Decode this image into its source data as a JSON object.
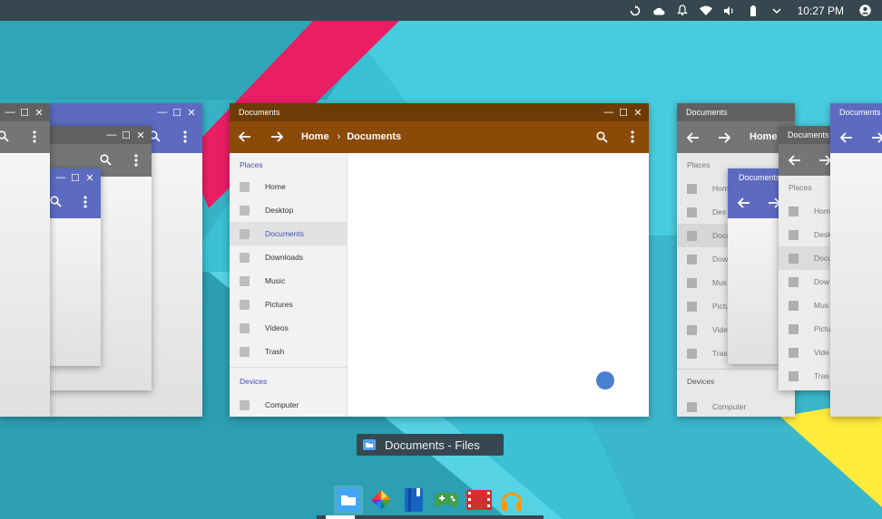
{
  "status_bar": {
    "time": "10:27 PM",
    "icons": [
      "sync-icon",
      "cloud-icon",
      "bell-icon",
      "wifi-icon",
      "volume-icon",
      "battery-icon",
      "chevron-down-icon",
      "account-icon"
    ]
  },
  "main_window": {
    "title": "Documents",
    "breadcrumb": {
      "home": "Home",
      "separator": "›",
      "current": "Documents"
    },
    "sidebar": {
      "places_header": "Places",
      "places": [
        "Home",
        "Desktop",
        "Documents",
        "Downloads",
        "Music",
        "Pictures",
        "Videos",
        "Trash"
      ],
      "active": "Documents",
      "devices_header": "Devices",
      "devices": [
        "Computer"
      ]
    },
    "colors": {
      "titlebar": "#6d3b05",
      "toolbar": "#8b4a08",
      "accent": "#3f51b5"
    }
  },
  "right_windows": {
    "win1": {
      "title": "Documents",
      "home": "Home",
      "places_header": "Places",
      "places": [
        "Hom",
        "Des",
        "Docu",
        "Dow",
        "Mus",
        "Pictu",
        "Vide",
        "Tras"
      ],
      "devices_header": "Devices",
      "devices": [
        "Computer"
      ]
    },
    "win2": {
      "title": "Documents"
    },
    "win3": {
      "title": "Documents",
      "places_header": "Places",
      "places": [
        "Hom",
        "Desk",
        "Docu",
        "Dow",
        "Mus",
        "Pictu",
        "Vide",
        "Tras"
      ]
    },
    "win4": {
      "title": "Documents"
    }
  },
  "tooltip": {
    "label": "Documents - Files"
  },
  "shelf": {
    "apps": [
      "files-icon",
      "photos-icon",
      "notes-icon",
      "games-icon",
      "video-icon",
      "music-icon"
    ]
  }
}
